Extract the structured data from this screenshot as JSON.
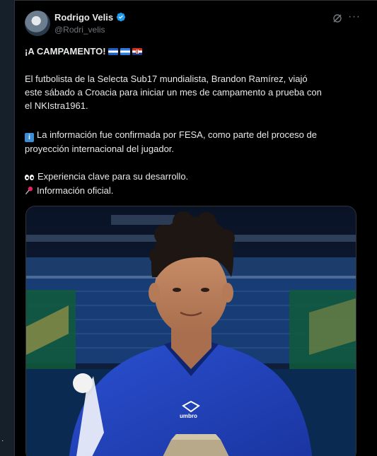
{
  "author": {
    "display_name": "Rodrigo Velis",
    "handle": "@Rodri_velis",
    "verified": true
  },
  "header_icons": [
    "grok-icon",
    "more-icon"
  ],
  "post": {
    "headline": "¡A CAMPAMENTO!",
    "headline_flags": [
      "el-salvador-flag",
      "honduras-flag",
      "croatia-flag"
    ],
    "paragraph1": "El futbolista de la Selecta Sub17 mundialista, Brandon Ramírez, viajó",
    "paragraph1_line2": "este sábado a Croacia para iniciar un mes de campamento a prueba con",
    "paragraph1_line3": "el NKIstra1961.",
    "paragraph2_line1": "La información fue confirmada por FESA, como parte del proceso de",
    "paragraph2_line2": "proyección internacional del jugador.",
    "line_eyes": "Experiencia clave para su desarrollo.",
    "line_pin": "Información oficial."
  },
  "media": {
    "jersey_brand": "umbro",
    "accent_colors": {
      "jersey": "#1e3fb0",
      "stadium_green": "#0f5a3a",
      "background": "#0b1428"
    }
  },
  "colors": {
    "text": "#e7e9ea",
    "muted": "#71767b",
    "verified": "#1d9bf0",
    "page_bg": "#000000"
  }
}
